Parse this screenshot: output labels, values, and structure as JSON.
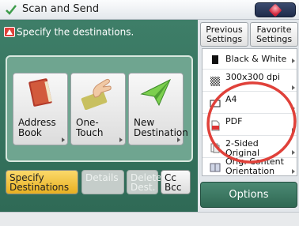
{
  "title_bar": {
    "title": "Scan and Send",
    "app_icon": "check-arrow-icon",
    "status_icon": "diamond-status-icon"
  },
  "instruction": {
    "icon": "warning-icon",
    "text": "Specify the destinations."
  },
  "destination_buttons": [
    {
      "label": "Address\nBook",
      "icon": "address-book-icon"
    },
    {
      "label": "One-Touch",
      "icon": "hand-touch-icon"
    },
    {
      "label": "New\nDestination",
      "icon": "paper-plane-icon"
    }
  ],
  "tabs": [
    {
      "label": "Specify\nDestinations",
      "state": "active"
    },
    {
      "label": "Details",
      "state": "disabled"
    },
    {
      "label": "Delete\nDest.",
      "state": "disabled"
    },
    {
      "label": "Cc\nBcc",
      "state": "normal"
    }
  ],
  "top_buttons": {
    "previous": "Previous\nSettings",
    "favorite": "Favorite\nSettings"
  },
  "settings": [
    {
      "label": "Black & White",
      "icon": "black-white-icon"
    },
    {
      "label": "300x300 dpi",
      "icon": "resolution-icon"
    },
    {
      "label": "A4",
      "icon": "paper-size-icon"
    },
    {
      "label": "PDF",
      "icon": "pdf-file-icon"
    },
    {
      "label": "2-Sided\nOriginal",
      "icon": "two-sided-icon"
    },
    {
      "label": "Orig. Content\nOrientation",
      "icon": "orientation-icon"
    }
  ],
  "options_label": "Options",
  "colors": {
    "panel_green": "#3a7a63",
    "active_tab": "#f5c842",
    "annotation_red": "#e0413a"
  }
}
